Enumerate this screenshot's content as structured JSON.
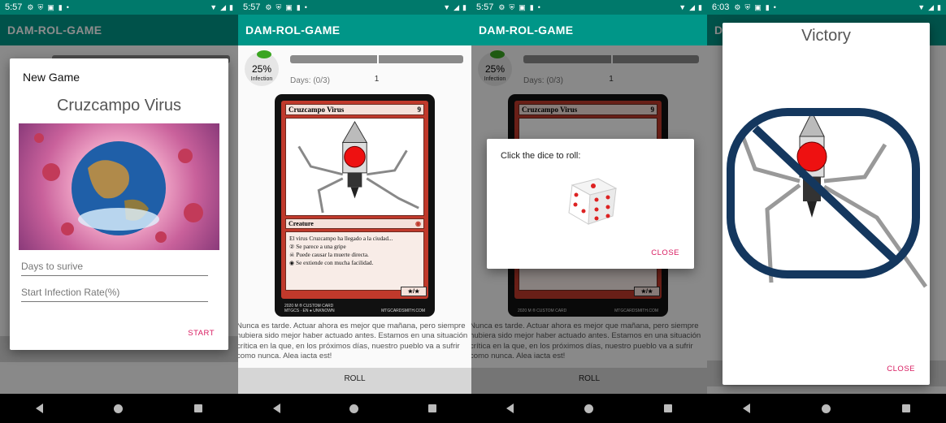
{
  "status": {
    "time_1": "5:57",
    "time_2": "5:57",
    "time_3": "5:57",
    "time_4": "6:03"
  },
  "app": {
    "title": "DAM-ROL-GAME"
  },
  "infection": {
    "percent": "25%",
    "label": "Infection",
    "fill_fraction": 0.25
  },
  "progress": {
    "value": "1",
    "days": "Days: (0/3)"
  },
  "new_game_dialog": {
    "title": "New Game",
    "virus_name": "Cruzcampo Virus",
    "days_placeholder": "Days to surive",
    "rate_placeholder": "Start Infection Rate(%)",
    "start_label": "START"
  },
  "card": {
    "name": "Cruzcampo Virus",
    "cost": "9",
    "type": "Creature",
    "rules": [
      "El virus Cruzcampo ha llegado a la ciudad...",
      "Se parece a una gripe",
      "Puede causar la muerte directa.",
      "Se extiende con mucha facilidad."
    ],
    "pt": "★/★",
    "footer_left": "2020 M ® CUSTOM CARD",
    "footer_left2": "MTGCS · EN ● UNKNOWN",
    "footer_right": "MTGCARDSMITH.COM"
  },
  "description": "Nunca es tarde. Actuar ahora es mejor que mañana, pero siempre hubiera sido mejor haber actuado antes. Estamos en una situación crítica en la que, en los próximos días, nuestro pueblo va a sufrir como nunca. Alea iacta est!",
  "roll_label": "ROLL",
  "dice_dialog": {
    "prompt": "Click the dice to roll:",
    "close_label": "CLOSE"
  },
  "victory_dialog": {
    "title": "Victory",
    "close_label": "CLOSE"
  },
  "colors": {
    "accent": "#009688",
    "status": "#00796b",
    "button_text": "#d81b60",
    "victory_ring": "#14375e"
  }
}
